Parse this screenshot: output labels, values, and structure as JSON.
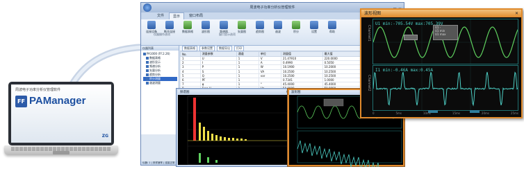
{
  "laptop": {
    "subtitle": "周波电子功率分析仪管理软件",
    "logo_mark": "FF",
    "app_name": "PAManager",
    "brand": "ZG"
  },
  "window": {
    "title": "周波电子功率分析仪管理软件",
    "tabs": [
      "文件",
      "显示",
      "窗口布局"
    ],
    "active_tab": 1,
    "ribbon": [
      {
        "label": "连接设备",
        "icon": "connect-icon"
      },
      {
        "label": "断开连接",
        "icon": "disconnect-icon"
      },
      {
        "label": "数据表格",
        "icon": "table-icon"
      },
      {
        "label": "波形图",
        "icon": "wave-icon"
      },
      {
        "label": "频谱图",
        "icon": "spectrum-icon"
      },
      {
        "label": "矢量图",
        "icon": "vector-icon"
      },
      {
        "label": "趋势图",
        "icon": "trend-icon"
      },
      {
        "label": "谐波",
        "icon": "harmonic-icon"
      },
      {
        "label": "积分",
        "icon": "integral-icon"
      },
      {
        "label": "设置",
        "icon": "settings-icon"
      },
      {
        "label": "帮助",
        "icon": "help-icon"
      }
    ],
    "ribbon_groups": [
      "仪器操作选项",
      "窗口显示选项"
    ],
    "tree_title": "仪器列表",
    "tree": [
      {
        "label": "PA1000 (FF.2.26)",
        "selected": false
      },
      {
        "label": "数据表格",
        "selected": false
      },
      {
        "label": "波形显示",
        "selected": false
      },
      {
        "label": "频谱分析",
        "selected": false
      },
      {
        "label": "矢量分析",
        "selected": false
      },
      {
        "label": "趋势分析",
        "selected": false
      },
      {
        "label": "积分测量",
        "selected": true
      },
      {
        "label": "谐波测量",
        "selected": false
      }
    ],
    "grid_toolbar": [
      "数据表格",
      "参数设置",
      "数据导出",
      "打印"
    ],
    "columns": [
      "No.",
      "测量参数",
      "通道",
      "单位",
      "测量值",
      "最大值",
      "最小值"
    ],
    "rows": [
      [
        "1",
        "U",
        "1",
        "V",
        "21.47910",
        "220.0000",
        "21.4791"
      ],
      [
        "2",
        "I",
        "1",
        "A",
        "0.4990",
        "0.5050",
        "0.4990"
      ],
      [
        "3",
        "P",
        "1",
        "W",
        "10.1900",
        "10.2000",
        "0.7100"
      ],
      [
        "4",
        "S",
        "1",
        "VA",
        "10.2500",
        "10.2500",
        "0.2500"
      ],
      [
        "5",
        "Q",
        "1",
        "var",
        "10.2500",
        "10.2500",
        "0.2500"
      ],
      [
        "6",
        "PF",
        "1",
        "",
        "0.7341",
        "1.0000",
        "0.7341"
      ],
      [
        "7",
        "φ",
        "1",
        "°",
        "45.4000",
        "45.4000",
        "0.4534"
      ],
      [
        "8",
        "Freq-U",
        "1",
        "Hz",
        "50.0000",
        "50.0000",
        "49.9900"
      ],
      [
        "9",
        "Freq-I",
        "1",
        "Hz",
        "50.0000",
        "50.0000",
        "49.9900"
      ],
      [
        "10",
        "Upeak+",
        "1",
        "V",
        "28.5400",
        "28.5400",
        "28.5400"
      ],
      [
        "11",
        "Upeak-",
        "1",
        "V",
        "-28.5400",
        "-28.5400",
        "-28.5400"
      ],
      [
        "12",
        "Ipeak+",
        "1",
        "A",
        "0.6400",
        "0.6400",
        "0.6400"
      ]
    ],
    "highlight_row": 8,
    "spectrum_title": "频谱图",
    "wave_title": "波形图",
    "status": "仪器: 1 | 采样速率 | 连接正常"
  },
  "popup": {
    "title": "波形视图",
    "ch1_label": "Channel1",
    "ch1_info": "U1  min:-705.54V  max:705.39V",
    "ch2_label": "Channel2",
    "ch2_info": "I1  min:-0.46A  max:0.45A",
    "legend": [
      "U1 -",
      "U1 min",
      "U1 max"
    ],
    "x_ticks": [
      "0",
      "5ms",
      "10ms",
      "15ms",
      "20ms",
      "25ms"
    ]
  },
  "colors": {
    "accent": "#e08a2c",
    "wave_cyan": "#4dcfc5",
    "wave_green": "#5fd15f",
    "spectrum_yellow": "#f2e14a",
    "spectrum_red": "#e33"
  }
}
